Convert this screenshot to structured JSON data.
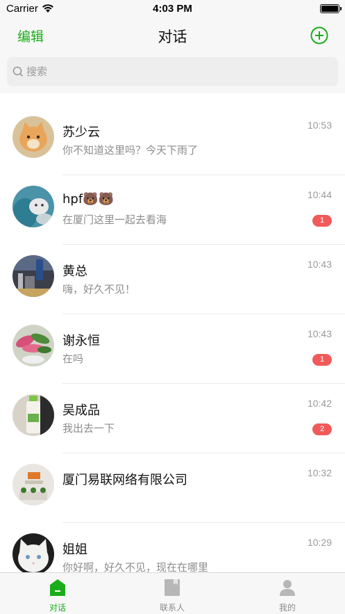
{
  "status_bar": {
    "carrier": "Carrier",
    "time": "4:03 PM"
  },
  "nav": {
    "edit_label": "编辑",
    "title": "对话",
    "add_icon": "plus-circle-icon"
  },
  "search": {
    "placeholder": "搜索"
  },
  "colors": {
    "accent": "#1aad19",
    "badge": "#f05a5a",
    "muted": "#9a9a9a"
  },
  "conversations": [
    {
      "name": "苏少云",
      "message": "你不知道这里吗？今天下雨了",
      "time": "10:53",
      "badge": "",
      "avatar": "orange-cat"
    },
    {
      "name": "hpf🐻🐻",
      "message": "在厦门这里一起去看海",
      "time": "10:44",
      "badge": "1",
      "avatar": "person-with-cat"
    },
    {
      "name": "黄总",
      "message": "嗨，好久不见！",
      "time": "10:43",
      "badge": "",
      "avatar": "street-scene"
    },
    {
      "name": "谢永恒",
      "message": "在吗",
      "time": "10:43",
      "badge": "1",
      "avatar": "potted-plant"
    },
    {
      "name": "吴成品",
      "message": "我出去一下",
      "time": "10:42",
      "badge": "2",
      "avatar": "bottle"
    },
    {
      "name": "厦门易联网络有限公司",
      "message": "",
      "time": "10:32",
      "badge": "",
      "avatar": "office-reception"
    },
    {
      "name": "姐姐",
      "message": "你好啊，好久不见，现在在哪里",
      "time": "10:29",
      "badge": "",
      "avatar": "white-cat"
    }
  ],
  "tabs": [
    {
      "label": "对话",
      "icon": "chat-house-icon",
      "active": true
    },
    {
      "label": "联系人",
      "icon": "contacts-book-icon",
      "active": false
    },
    {
      "label": "我的",
      "icon": "person-icon",
      "active": false
    }
  ]
}
